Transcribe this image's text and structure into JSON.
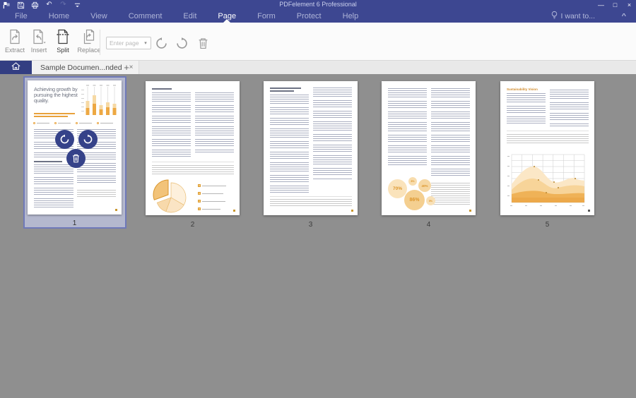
{
  "window": {
    "title": "PDFelement 6 Professional",
    "controls": {
      "minimize": "—",
      "maximize": "□",
      "close": "×"
    }
  },
  "quick_access": {
    "undo_glyph": "↶",
    "redo_glyph": "↷"
  },
  "menu": {
    "items": [
      "File",
      "Home",
      "View",
      "Comment",
      "Edit",
      "Page",
      "Form",
      "Protect",
      "Help"
    ],
    "active_item": "Page",
    "i_want_to": "I want to...",
    "collapse_glyph": "^"
  },
  "ribbon": {
    "buttons": [
      {
        "label": "Extract"
      },
      {
        "label": "Insert"
      },
      {
        "label": "Split",
        "emphasized": true
      },
      {
        "label": "Replace"
      }
    ],
    "page_range": {
      "placeholder": "Enter page r...",
      "dropdown_glyph": "▾"
    },
    "tools": [
      "rotate-left",
      "rotate-right",
      "delete"
    ]
  },
  "tab_bar": {
    "document_tab": "Sample Documen...nded",
    "close_glyph": "×",
    "new_tab_glyph": "+"
  },
  "pages": [
    {
      "number": "1",
      "selected": true,
      "title": "Achieving growth by pursuing the highest quality."
    },
    {
      "number": "2"
    },
    {
      "number": "3"
    },
    {
      "number": "4",
      "bubbles": [
        "70%",
        "8%",
        "40%",
        "86%",
        "5%"
      ]
    },
    {
      "number": "5",
      "heading": "Sustainability Vision"
    }
  ],
  "colors": {
    "header": "#3d4791",
    "header_dark": "#333e82",
    "accent_orange": "#e8a23c",
    "selection_border": "#6f79b9",
    "selection_bg": "#b4b8ce",
    "canvas_bg": "#8f8f8f"
  }
}
